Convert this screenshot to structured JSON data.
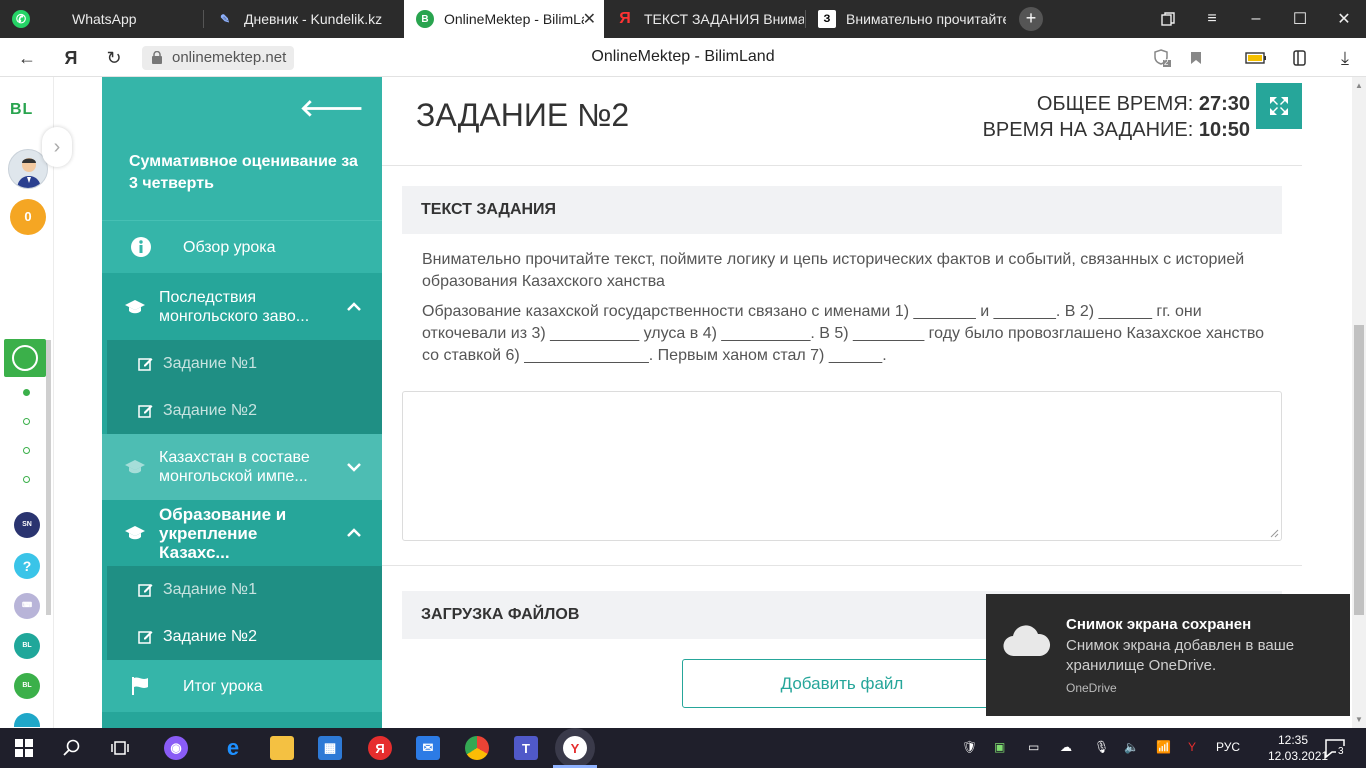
{
  "browser": {
    "tabs": [
      {
        "label": "WhatsApp",
        "icon": "whatsapp-icon"
      },
      {
        "label": "Дневник - Kundelik.kz",
        "icon": "kundelik-icon"
      },
      {
        "label": "OnlineMektep - BilimLand",
        "icon": "bilimland-icon",
        "active": true
      },
      {
        "label": "ТЕКСТ ЗАДАНИЯ Внимательно",
        "icon": "yandex-icon"
      },
      {
        "label": "Внимательно прочитайте",
        "icon": "znanija-icon"
      }
    ],
    "url": "onlinemektep.net",
    "page_title": "OnlineMektep - BilimLand",
    "extension_badge": "2"
  },
  "rail": {
    "logo": "BL",
    "score": "0"
  },
  "sidebar": {
    "title": "Суммативное оценивание за 3 четверть",
    "overview": "Обзор урока",
    "sections": [
      {
        "label": "Последствия монгольского заво...",
        "expanded": true,
        "tasks": [
          "Задание №1",
          "Задание №2"
        ]
      },
      {
        "label": "Казахстан в составе монгольской импе...",
        "expanded": false
      },
      {
        "label": "Образование и укрепление Казахс...",
        "expanded": true,
        "tasks": [
          "Задание №1",
          "Задание №2"
        ]
      }
    ],
    "summary": "Итог урока"
  },
  "main": {
    "task_title": "ЗАДАНИЕ №2",
    "total_time_label": "ОБЩЕЕ ВРЕМЯ:",
    "total_time": "27:30",
    "task_time_label": "ВРЕМЯ НА ЗАДАНИЕ:",
    "task_time": "10:50",
    "text_header": "ТЕКСТ ЗАДАНИЯ",
    "instruction": "Внимательно прочитайте текст, поймите логику и цепь исторических фактов и событий, связанных с историей образования Казахского ханства",
    "passage": "Образование казахской государственности связано с именами 1) _______ и _______. В 2) ______ гг. они откочевали из 3) __________ улуса в 4) __________. В 5) ________ году было провозглашено Казахское ханство со ставкой 6) ______________. Первым ханом стал 7) ______.",
    "answer_value": "",
    "upload_header": "ЗАГРУЗКА ФАЙЛОВ",
    "add_file": "Добавить файл"
  },
  "toast": {
    "title": "Снимок экрана сохранен",
    "body": "Снимок экрана добавлен в ваше хранилище OneDrive.",
    "source": "OneDrive"
  },
  "taskbar": {
    "language": "РУС",
    "time": "12:35",
    "date": "12.03.2021",
    "notifications": "3"
  }
}
